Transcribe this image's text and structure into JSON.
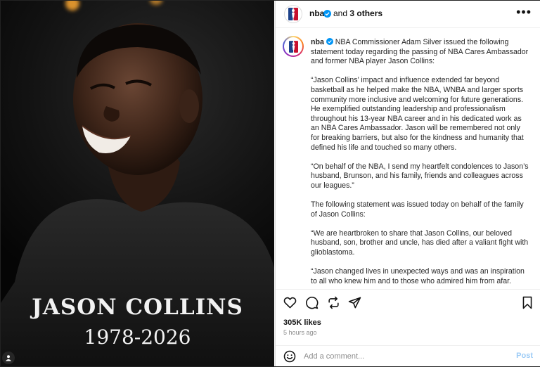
{
  "media": {
    "name_text": "JASON COLLINS",
    "years_text": "1978-2026",
    "user_tag_icon": "person-icon"
  },
  "header": {
    "username": "nba",
    "verified_icon": "verified-badge-icon",
    "others_prefix": "and ",
    "others_count": "3 others",
    "more_icon": "more-options-icon"
  },
  "caption": {
    "username": "nba",
    "paragraphs": [
      "NBA Commissioner Adam Silver issued the following statement today regarding the passing of NBA Cares Ambassador and former NBA player Jason Collins:",
      "“Jason Collins’ impact and influence extended far beyond basketball as he helped make the NBA, WNBA and larger sports community more inclusive and welcoming for future generations. He exemplified outstanding leadership and professionalism throughout his 13-year NBA career and in his dedicated work as an NBA Cares Ambassador. Jason will be remembered not only for breaking barriers, but also for the kindness and humanity that defined his life and touched so many others.",
      "“On behalf of the NBA, I send my heartfelt condolences to Jason’s husband, Brunson, and his family, friends and colleagues across our leagues.”",
      "The following statement was issued today on behalf of the family of Jason Collins:",
      "“We are heartbroken to share that Jason Collins, our beloved husband, son, brother and uncle, has died after a valiant fight with glioblastoma.",
      "“Jason changed lives in unexpected ways and was an inspiration to all who knew him and to those who admired him from afar."
    ]
  },
  "actions": {
    "icons": [
      "heart-icon",
      "comment-icon",
      "repost-icon",
      "share-icon",
      "bookmark-icon"
    ]
  },
  "stats": {
    "likes": "305K likes",
    "time": "5 hours ago"
  },
  "comment": {
    "placeholder": "Add a comment...",
    "post_label": "Post",
    "emoji_icon": "emoji-icon"
  },
  "colors": {
    "accent": "#0095f6",
    "post_disabled": "#9ccbf6",
    "verified": "#0095f6",
    "text": "#262626",
    "muted": "#8e8e8e"
  }
}
